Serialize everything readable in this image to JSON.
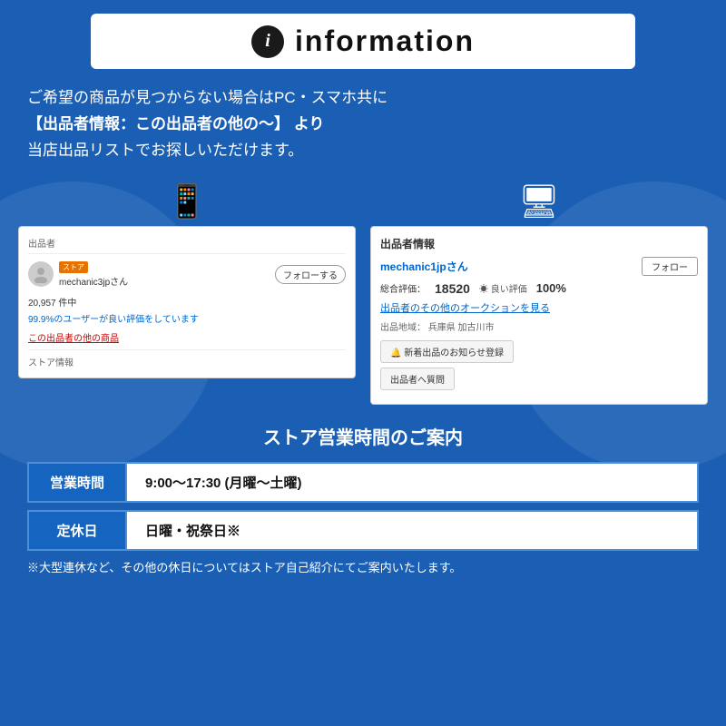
{
  "header": {
    "icon_char": "i",
    "title": "information"
  },
  "main_text": {
    "line1": "ご希望の商品が見つからない場合はPC・スマホ共に",
    "line2": "【出品者情報：この出品者の他の〜】 より",
    "line3": "当店出品リストでお探しいただけます。"
  },
  "mobile_screenshot": {
    "seller_label": "出品者",
    "store_badge": "ストア",
    "seller_name": "mechanic3jpさん",
    "follow_button": "フォローする",
    "count": "20,957 件中",
    "rating": "99.9%のユーザーが良い評価をしています",
    "link": "この出品者の他の商品",
    "store_info": "ストア情報"
  },
  "pc_screenshot": {
    "seller_info_label": "出品者情報",
    "seller_name": "mechanic1jpさん",
    "follow_button": "フォロー",
    "rating_label": "総合評価：",
    "rating_num": "18520",
    "good_label": "☀ 良い評価",
    "good_pct": "100%",
    "auction_link": "出品者のその他のオークションを見る",
    "region_label": "出品地域：",
    "region_value": "兵庫県 加古川市",
    "notification_btn": "🔔 新着出品のお知らせ登録",
    "question_btn": "出品者へ質問"
  },
  "hours_section": {
    "title": "ストア営業時間のご案内",
    "rows": [
      {
        "label": "営業時間",
        "value": "9:00〜17:30 (月曜〜土曜)"
      },
      {
        "label": "定休日",
        "value": "日曜・祝祭日※"
      }
    ],
    "footer_note": "※大型連休など、その他の休日についてはストア自己紹介にてご案内いたします。"
  }
}
